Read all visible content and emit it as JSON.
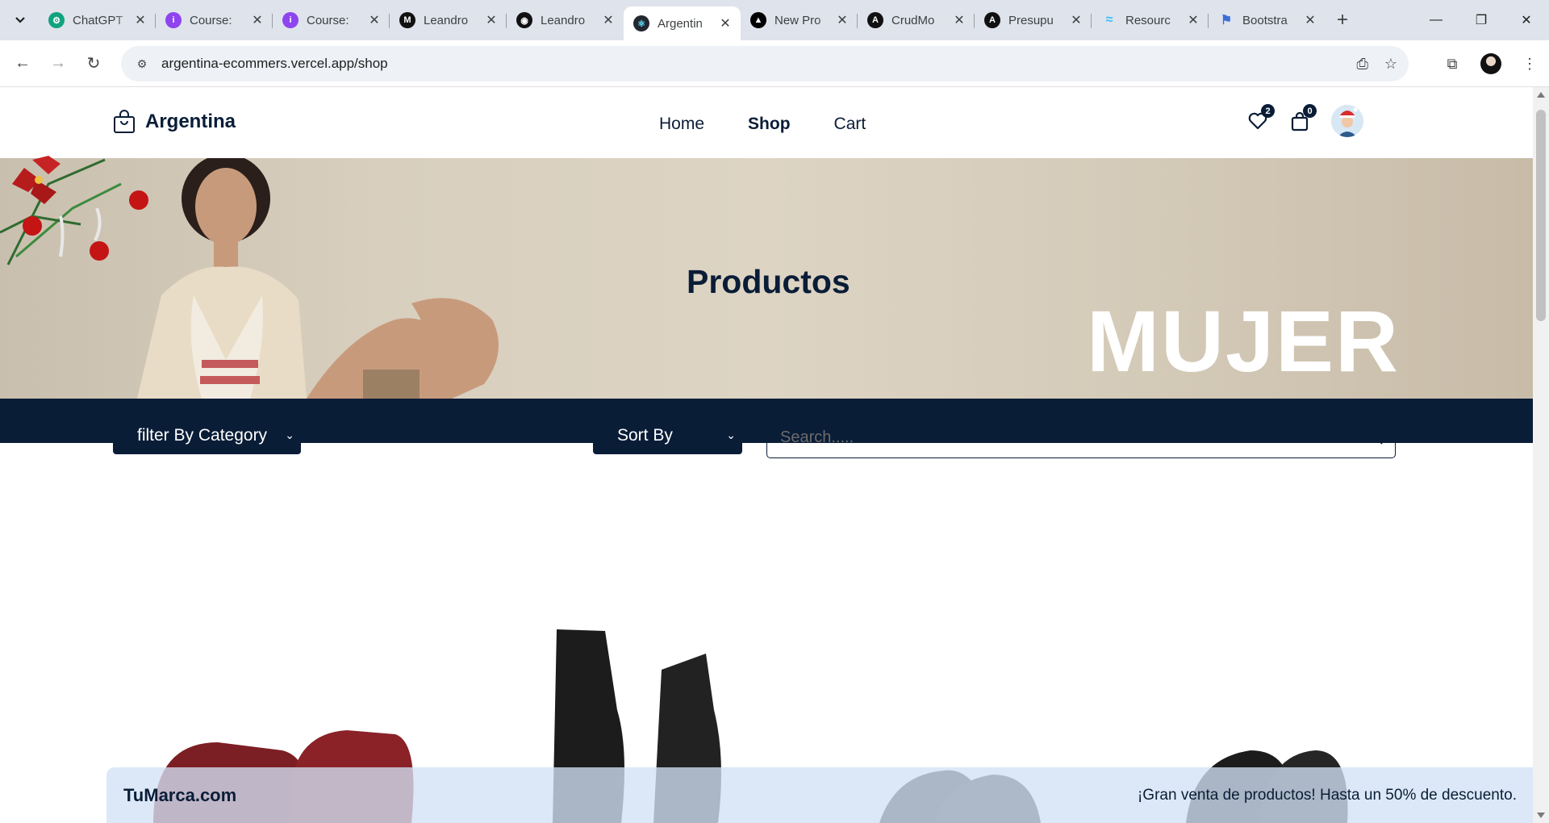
{
  "browser": {
    "tabs": [
      {
        "title": "ChatGPT",
        "icon": "chatgpt-icon",
        "color": "#10a37f",
        "active": false
      },
      {
        "title": "Course: ",
        "icon": "course-icon",
        "color": "#8e44ef",
        "active": false
      },
      {
        "title": "Course: ",
        "icon": "course-icon",
        "color": "#8e44ef",
        "active": false
      },
      {
        "title": "Leandro",
        "icon": "medium-icon",
        "color": "#111111",
        "active": false
      },
      {
        "title": "Leandro",
        "icon": "github-icon",
        "color": "#111111",
        "active": false
      },
      {
        "title": "Argentin",
        "icon": "react-icon",
        "color": "#23272f",
        "active": true
      },
      {
        "title": "New Pro",
        "icon": "vercel-icon",
        "color": "#000000",
        "active": false
      },
      {
        "title": "CrudMo",
        "icon": "angular-icon",
        "color": "#111111",
        "active": false
      },
      {
        "title": "Presupu",
        "icon": "angular-icon",
        "color": "#111111",
        "active": false
      },
      {
        "title": "Resourc",
        "icon": "tailwind-icon",
        "color": "#38bdf8",
        "active": false
      },
      {
        "title": "Bootstra",
        "icon": "flag-icon",
        "color": "#3b6fd6",
        "active": false
      }
    ],
    "url": "argentina-ecommers.vercel.app/shop"
  },
  "header": {
    "logo_text": "Argentina",
    "nav": [
      {
        "label": "Home",
        "active": false
      },
      {
        "label": "Shop",
        "active": true
      },
      {
        "label": "Cart",
        "active": false
      }
    ],
    "wishlist_count": "2",
    "cart_count": "0"
  },
  "hero": {
    "title": "Productos",
    "overlay_text": "MUJER"
  },
  "controls": {
    "filter_label": "filter By Category",
    "sort_label": "Sort By",
    "search_placeholder": "Search....."
  },
  "footer_bar": {
    "brand": "TuMarca.com",
    "promo": "¡Gran venta de productos! Hasta un 50% de descuento."
  },
  "colors": {
    "primary": "#0a1d37",
    "hero_bg": "#d8cfbe",
    "tab_strip": "#dfe3eb"
  }
}
